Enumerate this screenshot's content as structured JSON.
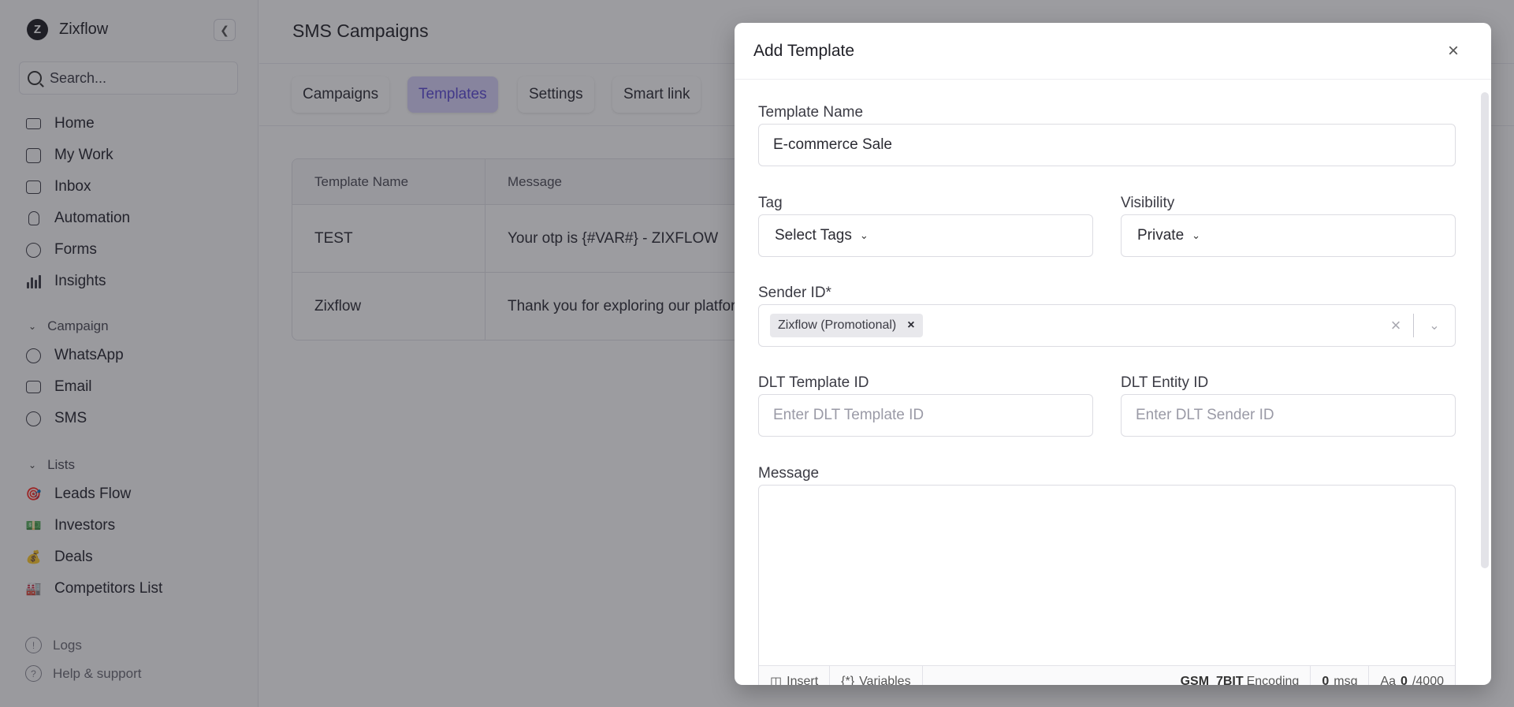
{
  "app": {
    "name": "Zixflow"
  },
  "sidebar": {
    "search_placeholder": "Search...",
    "nav": [
      {
        "label": "Home",
        "icon": "laptop-icon"
      },
      {
        "label": "My Work",
        "icon": "checkbox-icon"
      },
      {
        "label": "Inbox",
        "icon": "inbox-icon"
      },
      {
        "label": "Automation",
        "icon": "bulb-icon"
      },
      {
        "label": "Forms",
        "icon": "chat-icon"
      },
      {
        "label": "Insights",
        "icon": "bar-chart-icon"
      }
    ],
    "campaign_section": "Campaign",
    "campaign_items": [
      {
        "label": "WhatsApp",
        "icon": "whatsapp-icon"
      },
      {
        "label": "Email",
        "icon": "mail-icon"
      },
      {
        "label": "SMS",
        "icon": "sms-icon"
      }
    ],
    "lists_section": "Lists",
    "list_items": [
      {
        "label": "Leads Flow",
        "emoji": "🎯"
      },
      {
        "label": "Investors",
        "emoji": "💵"
      },
      {
        "label": "Deals",
        "emoji": "💰"
      },
      {
        "label": "Competitors List",
        "emoji": "🏭"
      }
    ],
    "footer": [
      {
        "label": "Logs",
        "glyph": "!"
      },
      {
        "label": "Help & support",
        "glyph": "?"
      }
    ]
  },
  "main": {
    "title": "SMS Campaigns",
    "tabs": [
      {
        "label": "Campaigns"
      },
      {
        "label": "Templates",
        "active": true
      },
      {
        "label": "Settings"
      },
      {
        "label": "Smart link"
      }
    ],
    "table": {
      "headers": [
        "Template Name",
        "Message"
      ],
      "rows": [
        [
          "TEST",
          "Your otp is {#VAR#} - ZIXFLOW"
        ],
        [
          "Zixflow",
          "Thank you for exploring our platform"
        ]
      ]
    }
  },
  "modal": {
    "title": "Add Template",
    "template_name_label": "Template Name",
    "template_name_value": "E-commerce Sale",
    "tag_label": "Tag",
    "tag_value": "Select Tags",
    "visibility_label": "Visibility",
    "visibility_value": "Private",
    "sender_label": "Sender ID*",
    "sender_chip": "Zixflow (Promotional)",
    "dlt_template_label": "DLT Template ID",
    "dlt_template_placeholder": "Enter DLT Template ID",
    "dlt_entity_label": "DLT Entity ID",
    "dlt_entity_placeholder": "Enter DLT Sender ID",
    "message_label": "Message",
    "message_value": "",
    "toolbar": {
      "insert": "Insert",
      "variables": "Variables",
      "encoding_value": "GSM_7BIT",
      "encoding_label": "Encoding",
      "msg_count": "0",
      "msg_label": "msg",
      "char_prefix": "Aa",
      "char_count": "0",
      "char_limit": "/4000"
    }
  },
  "colors": {
    "accent": "#5b4ad6",
    "accent_bg": "#d9d4fb",
    "overlay": "#24242c"
  }
}
